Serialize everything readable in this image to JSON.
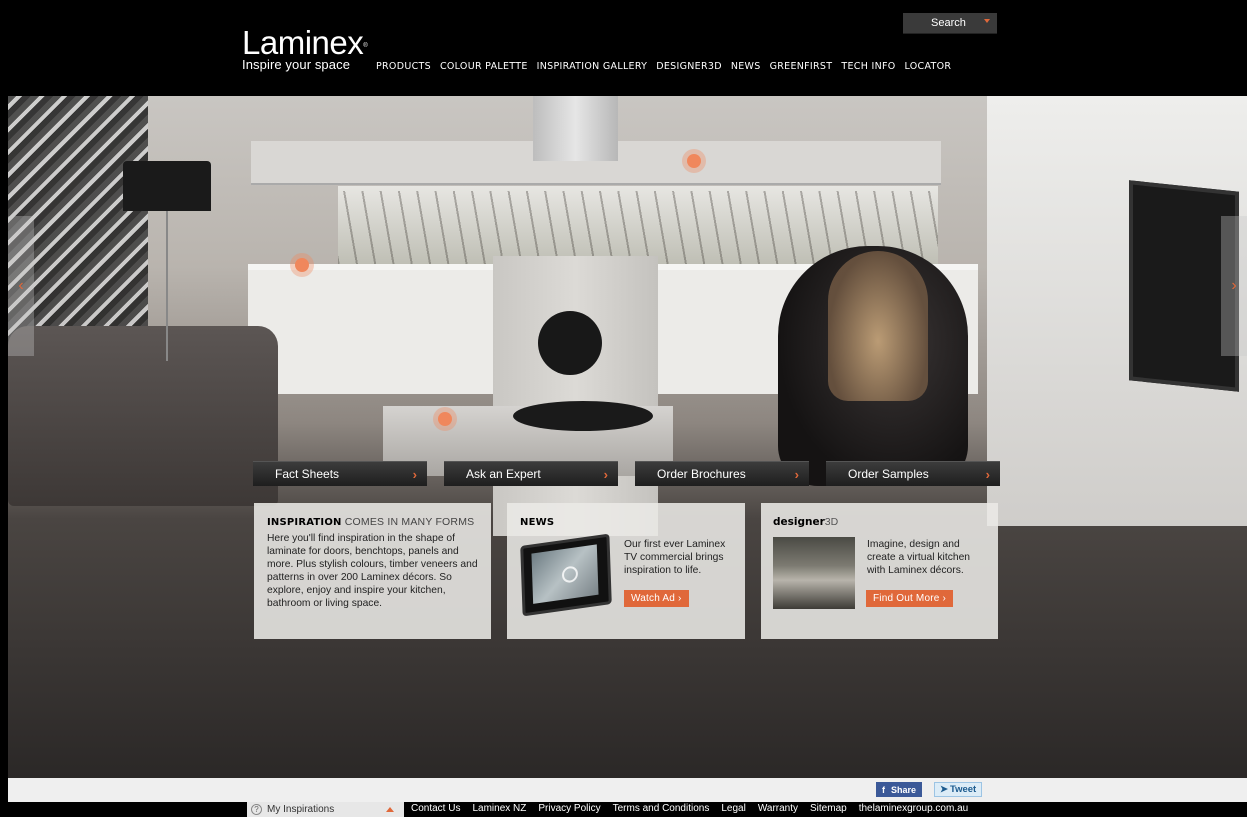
{
  "header": {
    "logo_word": "Laminex",
    "logo_reg": "®",
    "tagline": "Inspire your space",
    "search_label": "Search",
    "nav": [
      "PRODUCTS",
      "COLOUR PALETTE",
      "INSPIRATION GALLERY",
      "DESIGNER3D",
      "NEWS",
      "GREENFIRST",
      "TECH INFO",
      "LOCATOR"
    ]
  },
  "hero": {
    "prev_arrow": "‹",
    "next_arrow": "›"
  },
  "actions": [
    {
      "label": "Fact Sheets",
      "chevron": "›"
    },
    {
      "label": "Ask an Expert",
      "chevron": "›"
    },
    {
      "label": "Order Brochures",
      "chevron": "›"
    },
    {
      "label": "Order Samples",
      "chevron": "›"
    }
  ],
  "panels": {
    "inspiration": {
      "title_bold": "INSPIRATION",
      "title_rest": " COMES IN MANY FORMS",
      "text": "Here you'll find inspiration in the shape of laminate for doors, benchtops, panels and more. Plus stylish colours, timber veneers and patterns in over 200 Laminex décors. So explore, enjoy and inspire your kitchen, bathroom or living space."
    },
    "news": {
      "title": "NEWS",
      "text": "Our first ever Laminex TV commercial brings inspiration to life.",
      "button": "Watch Ad ›"
    },
    "designer3d": {
      "title_bold": "designer",
      "title_rest": "3D",
      "text": "Imagine, design and create a virtual kitchen with Laminex décors.",
      "button": "Find Out More ›"
    }
  },
  "share": {
    "facebook": "Share",
    "facebook_icon": "f",
    "twitter": "Tweet"
  },
  "footer": {
    "my_inspirations": "My Inspirations",
    "help_icon": "?",
    "links": [
      "Contact Us",
      "Laminex NZ",
      "Privacy Policy",
      "Terms and Conditions",
      "Legal",
      "Warranty",
      "Sitemap",
      "thelaminexgroup.com.au"
    ]
  },
  "colors": {
    "accent": "#e0683a",
    "facebook": "#3b5998",
    "topbar": "#000000"
  }
}
